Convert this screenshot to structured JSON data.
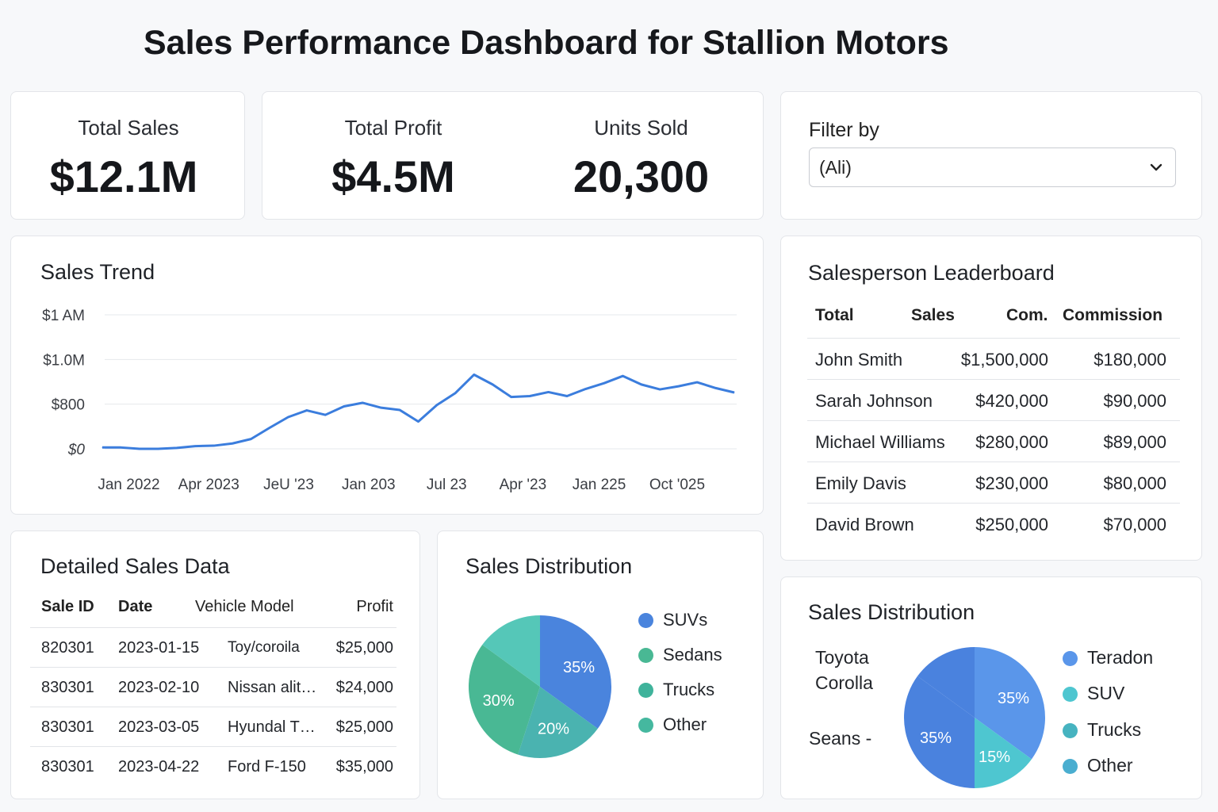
{
  "page": {
    "title": "Sales Performance Dashboard for Stallion Motors"
  },
  "kpis": {
    "total_sales": {
      "label": "Total Sales",
      "value": "$12.1M"
    },
    "total_profit": {
      "label": "Total Profit",
      "value": "$4.5M"
    },
    "units_sold": {
      "label": "Units Sold",
      "value": "20,300"
    }
  },
  "filter": {
    "label": "Filter by",
    "selected": "(Ali)",
    "chevron_icon": "chevron-down-icon"
  },
  "sales_trend": {
    "title": "Sales Trend",
    "line_color": "#3b7ddd"
  },
  "chart_data": [
    {
      "type": "line",
      "title": "Sales Trend",
      "y_tick_labels": [
        "$0",
        "$800",
        "$1.0M",
        "$1 AM"
      ],
      "y_tick_values": [
        0,
        1,
        2,
        3
      ],
      "x_tick_labels": [
        "Jan 2022",
        "Apr 2023",
        "JeU '23",
        "Jan 203",
        "Jul 23",
        "Apr '23",
        "Jan 225",
        "Oct '025"
      ],
      "x_tick_positions": [
        1,
        5.3,
        9.6,
        13.9,
        18.1,
        22.2,
        26.3,
        30.5
      ],
      "grid": true,
      "x": [
        0,
        1,
        2,
        3,
        4,
        5,
        6,
        7,
        8,
        9,
        10,
        11,
        12,
        13,
        14,
        15,
        16,
        17,
        18,
        19,
        20,
        21,
        22,
        23,
        24,
        25,
        26,
        27,
        28,
        29,
        30,
        31,
        32,
        33,
        34
      ],
      "values": [
        0.03,
        0.03,
        0.0,
        0.0,
        0.02,
        0.06,
        0.07,
        0.12,
        0.22,
        0.47,
        0.71,
        0.86,
        0.76,
        0.95,
        1.03,
        0.92,
        0.87,
        0.61,
        0.98,
        1.25,
        1.66,
        1.44,
        1.16,
        1.18,
        1.27,
        1.18,
        1.34,
        1.47,
        1.63,
        1.44,
        1.33,
        1.4,
        1.49,
        1.36,
        1.26
      ]
    },
    {
      "type": "pie",
      "title": "Sales Distribution",
      "labels": [
        "SUVs",
        "Sedans",
        "Trucks",
        "Other"
      ],
      "values": [
        35,
        30,
        20,
        15
      ],
      "slice_labels": [
        "35%",
        "20%",
        "30%"
      ],
      "colors": [
        "#4a84dd",
        "#49b894",
        "#4ab3b0",
        "#55c7b8"
      ]
    },
    {
      "type": "pie",
      "title": "Sales Distribution",
      "labels": [
        "Teradon",
        "SUV",
        "Trucks",
        "Other"
      ],
      "values": [
        35,
        15,
        35,
        15
      ],
      "slice_labels": [
        "35%",
        "15%",
        "35%"
      ],
      "colors": [
        "#5a96ea",
        "#4ec6d0",
        "#46b3c0",
        "#4a82de"
      ],
      "side_labels": [
        "Toyota",
        "Corolla",
        "Seans -"
      ]
    }
  ],
  "leaderboard": {
    "title": "Salesperson Leaderboard",
    "headers": [
      "Total",
      "Sales",
      "Com.",
      "Commission"
    ],
    "rows": [
      {
        "name": "John Smith",
        "sales": "$1,500,000",
        "commission": "$180,000"
      },
      {
        "name": "Sarah Johnson",
        "sales": "$420,000",
        "commission": "$90,000"
      },
      {
        "name": "Michael Williams",
        "sales": "$280,000",
        "commission": "$89,000"
      },
      {
        "name": "Emily Davis",
        "sales": "$230,000",
        "commission": "$80,000"
      },
      {
        "name": "David Brown",
        "sales": "$250,000",
        "commission": "$70,000"
      }
    ]
  },
  "detailed": {
    "title": "Detailed Sales Data",
    "headers": [
      "Sale ID",
      "Date",
      "Vehicle Model",
      "Profit"
    ],
    "rows": [
      {
        "id": "820301",
        "date": "2023-01-15",
        "model": "Toy/coroila",
        "profit": "$25,000"
      },
      {
        "id": "830301",
        "date": "2023-02-10",
        "model": "Nissan alit…",
        "profit": "$24,000"
      },
      {
        "id": "830301",
        "date": "2023-03-05",
        "model": "Hyundal T…",
        "profit": "$25,000"
      },
      {
        "id": "830301",
        "date": "2023-04-22",
        "model": "Ford F-150",
        "profit": "$35,000"
      }
    ]
  },
  "distribution1": {
    "title": "Sales Distribution",
    "legend": [
      "SUVs",
      "Sedans",
      "Trucks",
      "Other"
    ],
    "legend_colors": [
      "#4a84dd",
      "#49b894",
      "#3fb39b",
      "#45b89f"
    ]
  },
  "distribution2": {
    "title": "Sales Distribution",
    "legend": [
      "Teradon",
      "SUV",
      "Trucks",
      "Other"
    ],
    "legend_colors": [
      "#5a96ea",
      "#4ec6d0",
      "#46b3c0",
      "#4aaed0"
    ],
    "side_labels": [
      "Toyota",
      "Corolla",
      "Seans -"
    ]
  }
}
